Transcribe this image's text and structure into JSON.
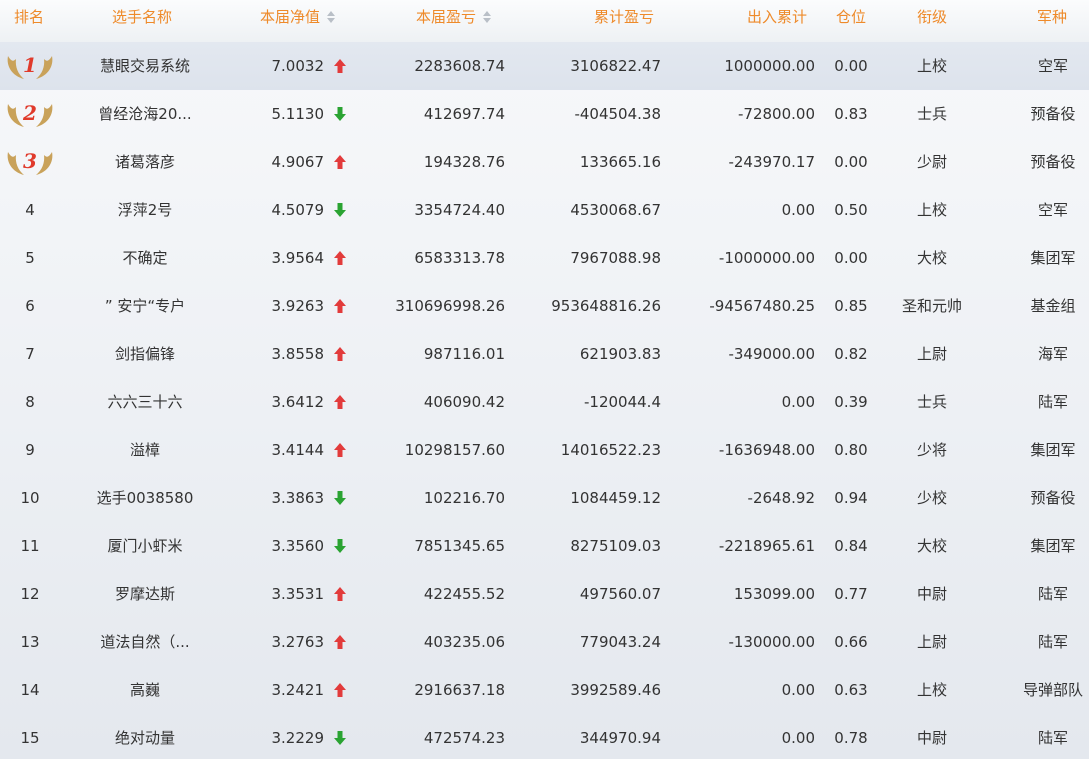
{
  "header": {
    "rank": "排名",
    "name": "选手名称",
    "nav": "本届净值",
    "pnl": "本届盈亏",
    "cum_pnl": "累计盈亏",
    "inout": "出入累计",
    "position": "仓位",
    "title": "衔级",
    "branch": "军种"
  },
  "colors": {
    "header_text": "#ee8a2a",
    "up": "#e23b3b",
    "down": "#2aa332",
    "medal_number": "#e03a2b",
    "medal_wing": "#c9a25a"
  },
  "rows": [
    {
      "rank": "1",
      "medal": true,
      "name": "慧眼交易系统",
      "nav": "7.0032",
      "dir": "up",
      "pnl": "2283608.74",
      "cum": "3106822.47",
      "inout": "1000000.00",
      "pos": "0.00",
      "title": "上校",
      "branch": "空军"
    },
    {
      "rank": "2",
      "medal": true,
      "name": "曾经沧海20...",
      "nav": "5.1130",
      "dir": "down",
      "pnl": "412697.74",
      "cum": "-404504.38",
      "inout": "-72800.00",
      "pos": "0.83",
      "title": "士兵",
      "branch": "预备役"
    },
    {
      "rank": "3",
      "medal": true,
      "name": "诸葛落彦",
      "nav": "4.9067",
      "dir": "up",
      "pnl": "194328.76",
      "cum": "133665.16",
      "inout": "-243970.17",
      "pos": "0.00",
      "title": "少尉",
      "branch": "预备役"
    },
    {
      "rank": "4",
      "medal": false,
      "name": "浮萍2号",
      "nav": "4.5079",
      "dir": "down",
      "pnl": "3354724.40",
      "cum": "4530068.67",
      "inout": "0.00",
      "pos": "0.50",
      "title": "上校",
      "branch": "空军"
    },
    {
      "rank": "5",
      "medal": false,
      "name": "不确定",
      "nav": "3.9564",
      "dir": "up",
      "pnl": "6583313.78",
      "cum": "7967088.98",
      "inout": "-1000000.00",
      "pos": "0.00",
      "title": "大校",
      "branch": "集团军"
    },
    {
      "rank": "6",
      "medal": false,
      "name": "” 安宁“专户",
      "nav": "3.9263",
      "dir": "up",
      "pnl": "310696998.26",
      "cum": "953648816.26",
      "inout": "-94567480.25",
      "pos": "0.85",
      "title": "圣和元帅",
      "branch": "基金组"
    },
    {
      "rank": "7",
      "medal": false,
      "name": "剑指偏锋",
      "nav": "3.8558",
      "dir": "up",
      "pnl": "987116.01",
      "cum": "621903.83",
      "inout": "-349000.00",
      "pos": "0.82",
      "title": "上尉",
      "branch": "海军"
    },
    {
      "rank": "8",
      "medal": false,
      "name": "六六三十六",
      "nav": "3.6412",
      "dir": "up",
      "pnl": "406090.42",
      "cum": "-120044.4",
      "inout": "0.00",
      "pos": "0.39",
      "title": "士兵",
      "branch": "陆军"
    },
    {
      "rank": "9",
      "medal": false,
      "name": "溢樟",
      "nav": "3.4144",
      "dir": "up",
      "pnl": "10298157.60",
      "cum": "14016522.23",
      "inout": "-1636948.00",
      "pos": "0.80",
      "title": "少将",
      "branch": "集团军"
    },
    {
      "rank": "10",
      "medal": false,
      "name": "选手0038580",
      "nav": "3.3863",
      "dir": "down",
      "pnl": "102216.70",
      "cum": "1084459.12",
      "inout": "-2648.92",
      "pos": "0.94",
      "title": "少校",
      "branch": "预备役"
    },
    {
      "rank": "11",
      "medal": false,
      "name": "厦门小虾米",
      "nav": "3.3560",
      "dir": "down",
      "pnl": "7851345.65",
      "cum": "8275109.03",
      "inout": "-2218965.61",
      "pos": "0.84",
      "title": "大校",
      "branch": "集团军"
    },
    {
      "rank": "12",
      "medal": false,
      "name": "罗摩达斯",
      "nav": "3.3531",
      "dir": "up",
      "pnl": "422455.52",
      "cum": "497560.07",
      "inout": "153099.00",
      "pos": "0.77",
      "title": "中尉",
      "branch": "陆军"
    },
    {
      "rank": "13",
      "medal": false,
      "name": "道法自然（...",
      "nav": "3.2763",
      "dir": "up",
      "pnl": "403235.06",
      "cum": "779043.24",
      "inout": "-130000.00",
      "pos": "0.66",
      "title": "上尉",
      "branch": "陆军"
    },
    {
      "rank": "14",
      "medal": false,
      "name": "高巍",
      "nav": "3.2421",
      "dir": "up",
      "pnl": "2916637.18",
      "cum": "3992589.46",
      "inout": "0.00",
      "pos": "0.63",
      "title": "上校",
      "branch": "导弹部队"
    },
    {
      "rank": "15",
      "medal": false,
      "name": "绝对动量",
      "nav": "3.2229",
      "dir": "down",
      "pnl": "472574.23",
      "cum": "344970.94",
      "inout": "0.00",
      "pos": "0.78",
      "title": "中尉",
      "branch": "陆军"
    }
  ]
}
